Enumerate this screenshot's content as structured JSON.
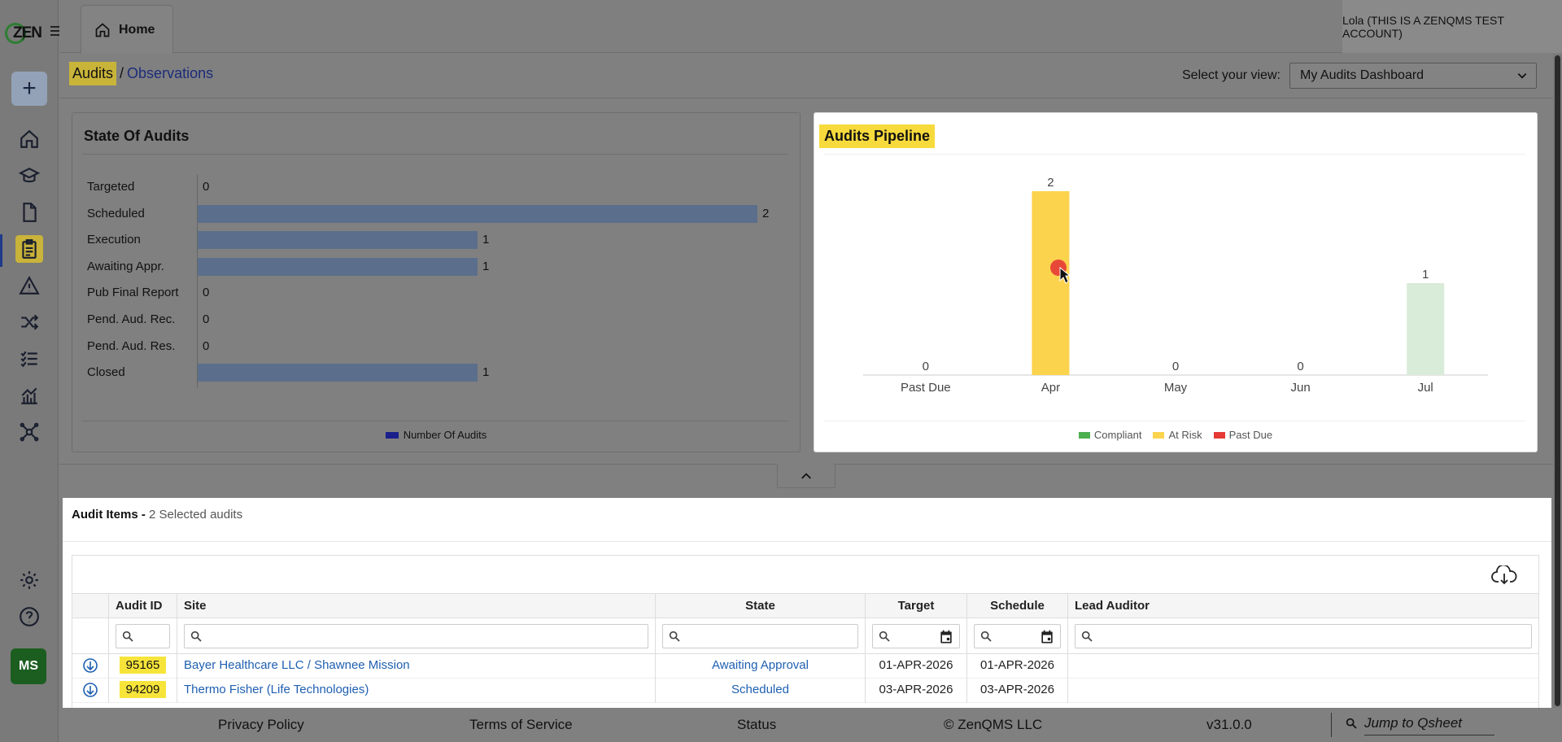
{
  "app": {
    "logo_text": "ZEN"
  },
  "topbar": {
    "home_tab": "Home",
    "user": "Lola (THIS IS A ZENQMS TEST ACCOUNT)"
  },
  "sidebar": {
    "items": [
      "add",
      "home",
      "training",
      "documents",
      "audits",
      "risks",
      "change",
      "tasks",
      "reports",
      "network"
    ],
    "bottom": [
      "settings",
      "help"
    ],
    "avatar_initials": "MS"
  },
  "breadcrumb": {
    "current": "Audits",
    "separator": "/",
    "link": "Observations"
  },
  "view_selector": {
    "label": "Select your view:",
    "value": "My Audits Dashboard"
  },
  "state_panel": {
    "title": "State Of Audits",
    "legend": "Number Of Audits",
    "chart_data": {
      "type": "bar",
      "orientation": "horizontal",
      "categories": [
        "Targeted",
        "Scheduled",
        "Execution",
        "Awaiting Appr.",
        "Pub Final Report",
        "Pend. Aud. Rec.",
        "Pend. Aud. Res.",
        "Closed"
      ],
      "values": [
        0,
        2,
        1,
        1,
        0,
        0,
        0,
        1
      ],
      "series_name": "Number Of Audits",
      "color": "#5b6f8c"
    }
  },
  "pipeline_panel": {
    "title": "Audits Pipeline",
    "chart_data": {
      "type": "bar",
      "categories": [
        "Past Due",
        "Apr",
        "May",
        "Jun",
        "Jul"
      ],
      "values": [
        0,
        2,
        0,
        0,
        1
      ],
      "bar_colors": [
        "#f8d04a",
        "#fcd34d",
        "#f8d04a",
        "#f8d04a",
        "#d9ebd9"
      ],
      "legend": [
        {
          "name": "Compliant",
          "color": "#4caf50"
        },
        {
          "name": "At Risk",
          "color": "#fcd34d"
        },
        {
          "name": "Past Due",
          "color": "#e53935"
        }
      ]
    }
  },
  "audit_items": {
    "title": "Audit Items - ",
    "subtitle": "2 Selected audits",
    "columns": [
      "Audit ID",
      "Site",
      "State",
      "Target",
      "Schedule",
      "Lead Auditor"
    ],
    "rows": [
      {
        "id": "95165",
        "site": "Bayer Healthcare LLC / Shawnee Mission",
        "state": "Awaiting Approval",
        "target": "01-APR-2026",
        "schedule": "01-APR-2026",
        "lead": ""
      },
      {
        "id": "94209",
        "site": "Thermo Fisher (Life Technologies)",
        "state": "Scheduled",
        "target": "03-APR-2026",
        "schedule": "03-APR-2026",
        "lead": ""
      }
    ]
  },
  "footer": {
    "privacy": "Privacy Policy",
    "terms": "Terms of Service",
    "status": "Status",
    "copyright": "© ZenQMS LLC",
    "version": "v31.0.0",
    "jump_placeholder": "Jump to Qsheet"
  }
}
